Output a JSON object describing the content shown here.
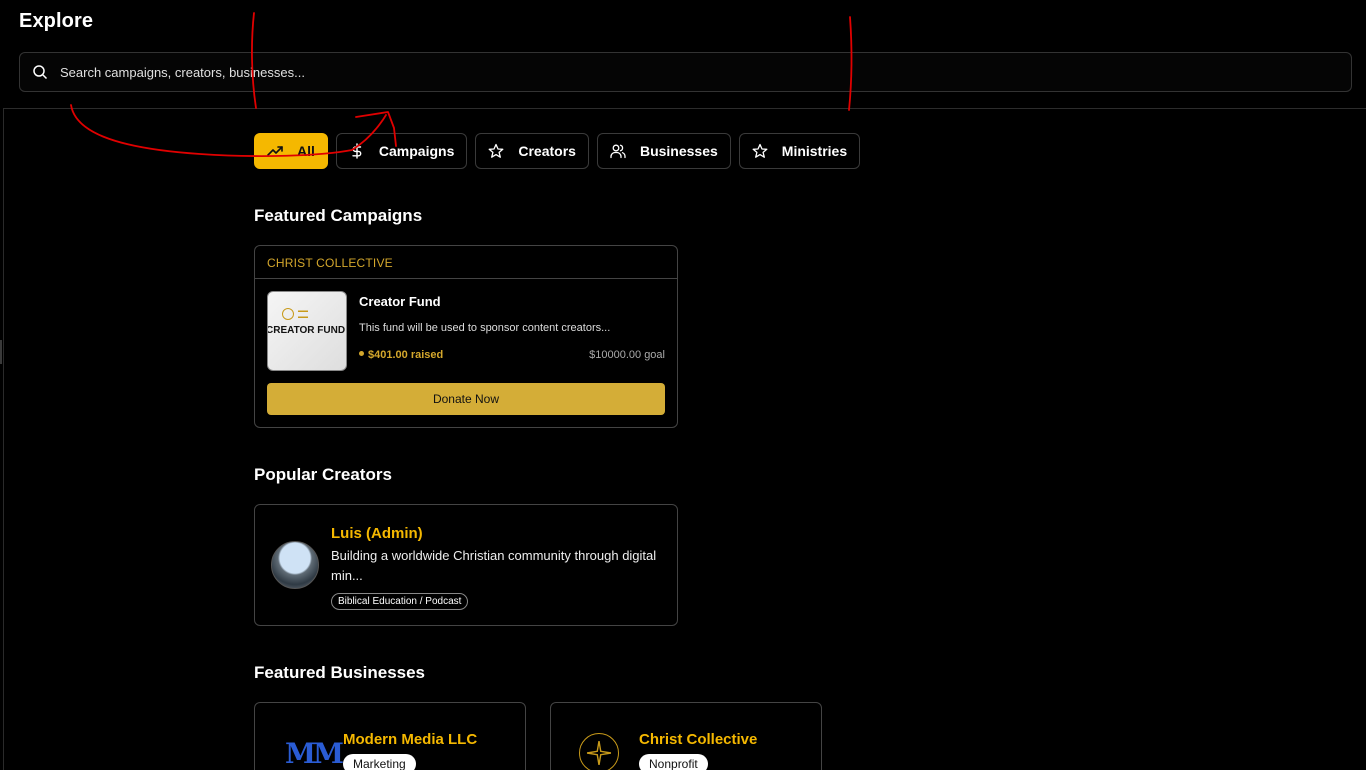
{
  "page": {
    "title": "Explore"
  },
  "search": {
    "placeholder": "Search campaigns, creators, businesses..."
  },
  "filters": [
    {
      "label": "All",
      "icon": "trending-up-icon",
      "active": true
    },
    {
      "label": "Campaigns",
      "icon": "dollar-icon",
      "active": false
    },
    {
      "label": "Creators",
      "icon": "star-icon",
      "active": false
    },
    {
      "label": "Businesses",
      "icon": "users-icon",
      "active": false
    },
    {
      "label": "Ministries",
      "icon": "star-icon",
      "active": false
    }
  ],
  "featured_campaigns": {
    "heading": "Featured Campaigns",
    "items": [
      {
        "organization": "CHRIST COLLECTIVE",
        "thumbnail_text": "CREATOR FUND",
        "name": "Creator Fund",
        "description": "This fund will be used to sponsor content creators...",
        "raised": "$401.00 raised",
        "goal": "$10000.00 goal",
        "cta": "Donate Now"
      }
    ]
  },
  "popular_creators": {
    "heading": "Popular Creators",
    "items": [
      {
        "name": "Luis (Admin)",
        "bio": "Building a worldwide Christian community through digital min...",
        "category": "Biblical Education / Podcast"
      }
    ]
  },
  "featured_businesses": {
    "heading": "Featured Businesses",
    "items": [
      {
        "name": "Modern Media LLC",
        "logo_text": "MM",
        "category": "Marketing"
      },
      {
        "name": "Christ Collective",
        "logo_icon": "compass-star-icon",
        "category": "Nonprofit"
      }
    ]
  },
  "colors": {
    "accent": "#f5b800",
    "gold": "#d4a72c",
    "button": "#d4ad37",
    "annotation": "#e00000",
    "background": "#000000"
  }
}
